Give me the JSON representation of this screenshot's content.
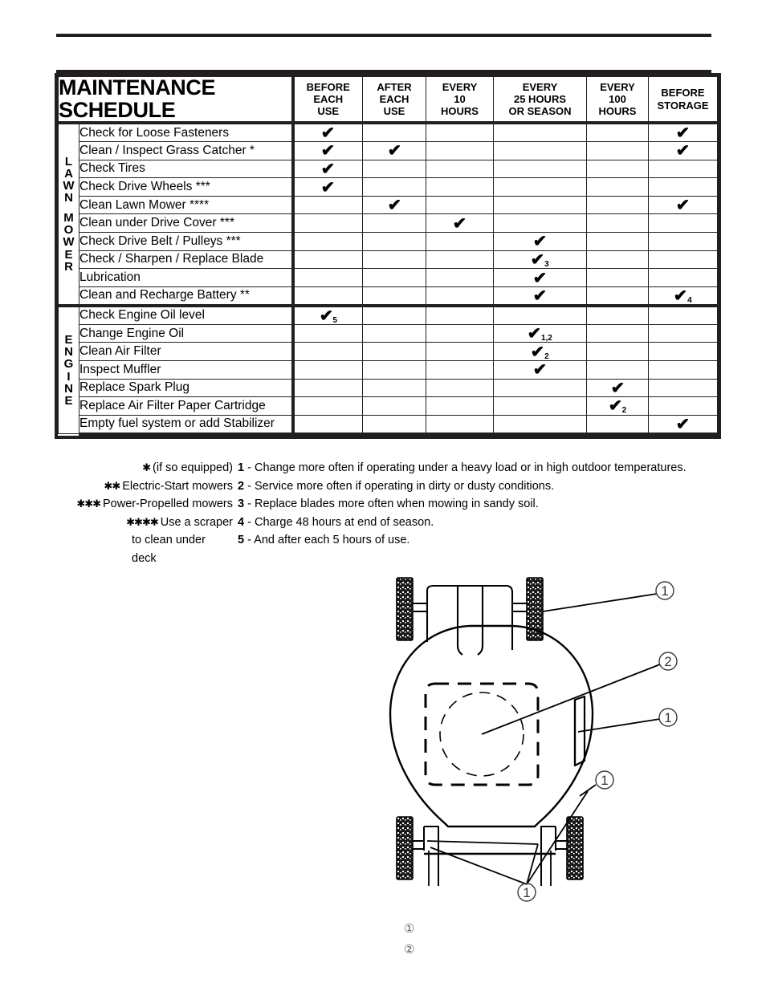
{
  "table": {
    "title_line1": "MAINTENANCE",
    "title_line2": "SCHEDULE",
    "columns": [
      {
        "id": "before_each_use",
        "lines": [
          "BEFORE",
          "EACH",
          "USE"
        ]
      },
      {
        "id": "after_each_use",
        "lines": [
          "AFTER",
          "EACH",
          "USE"
        ]
      },
      {
        "id": "every_10_hours",
        "lines": [
          "EVERY",
          "10",
          "HOURS"
        ]
      },
      {
        "id": "every_25_hours",
        "lines": [
          "EVERY",
          "25 HOURS",
          "OR SEASON"
        ]
      },
      {
        "id": "every_100_hours",
        "lines": [
          "EVERY",
          "100",
          "HOURS"
        ]
      },
      {
        "id": "before_storage",
        "lines": [
          "BEFORE",
          "STORAGE"
        ]
      }
    ],
    "sections": [
      {
        "label": "LAWN MOWER",
        "label_words": [
          "LAWN",
          "MOWER"
        ],
        "rows": [
          {
            "task": "Check for Loose Fasteners",
            "marks": [
              "check",
              "",
              "",
              "",
              "",
              "check"
            ]
          },
          {
            "task": "Clean / Inspect Grass Catcher *",
            "marks": [
              "check",
              "check",
              "",
              "",
              "",
              "check"
            ]
          },
          {
            "task": "Check Tires",
            "marks": [
              "check",
              "",
              "",
              "",
              "",
              ""
            ]
          },
          {
            "task": "Check Drive Wheels ***",
            "marks": [
              "check",
              "",
              "",
              "",
              "",
              ""
            ]
          },
          {
            "task": "Clean Lawn Mower ****",
            "marks": [
              "",
              "check",
              "",
              "",
              "",
              "check"
            ]
          },
          {
            "task": "Clean under Drive Cover ***",
            "marks": [
              "",
              "",
              "check",
              "",
              "",
              ""
            ]
          },
          {
            "task": "Check Drive Belt / Pulleys ***",
            "marks": [
              "",
              "",
              "",
              "check",
              "",
              ""
            ]
          },
          {
            "task": "Check / Sharpen / Replace Blade",
            "marks": [
              "",
              "",
              "",
              "check:3",
              "",
              ""
            ]
          },
          {
            "task": "Lubrication",
            "marks": [
              "",
              "",
              "",
              "check",
              "",
              ""
            ]
          },
          {
            "task": "Clean and Recharge Battery **",
            "marks": [
              "",
              "",
              "",
              "check",
              "",
              "check:4"
            ]
          }
        ]
      },
      {
        "label": "ENGINE",
        "label_words": [
          "ENGINE"
        ],
        "rows": [
          {
            "task": "Check Engine Oil level",
            "marks": [
              "check:5",
              "",
              "",
              "",
              "",
              ""
            ]
          },
          {
            "task": "Change Engine Oil",
            "marks": [
              "",
              "",
              "",
              "check:1,2",
              "",
              ""
            ]
          },
          {
            "task": "Clean Air Filter",
            "marks": [
              "",
              "",
              "",
              "check:2",
              "",
              ""
            ]
          },
          {
            "task": "Inspect Muffler",
            "marks": [
              "",
              "",
              "",
              "check",
              "",
              ""
            ]
          },
          {
            "task": "Replace Spark Plug",
            "marks": [
              "",
              "",
              "",
              "",
              "check",
              ""
            ]
          },
          {
            "task": "Replace Air Filter Paper Cartridge",
            "marks": [
              "",
              "",
              "",
              "",
              "check:2",
              ""
            ]
          },
          {
            "task": "Empty fuel system or add Stabilizer",
            "marks": [
              "",
              "",
              "",
              "",
              "",
              "check"
            ]
          }
        ]
      }
    ]
  },
  "footnotes": {
    "asterisks": [
      {
        "stars": "*",
        "text": "(if so equipped)"
      },
      {
        "stars": "**",
        "text": "Electric-Start mowers"
      },
      {
        "stars": "***",
        "text": "Power-Propelled mowers"
      },
      {
        "stars": "****",
        "text": "Use a scraper"
      }
    ],
    "asterisk_continuation": "to clean under deck",
    "numbered": [
      {
        "num": "1",
        "text": "- Change more often if operating under a heavy load or in high outdoor temperatures."
      },
      {
        "num": "2",
        "text": "- Service more often if operating in dirty or dusty conditions."
      },
      {
        "num": "3",
        "text": "- Replace blades more often when mowing in sandy soil."
      },
      {
        "num": "4",
        "text": "- Charge 48 hours at end of season."
      },
      {
        "num": "5",
        "text": "- And after each 5 hours of use."
      }
    ]
  },
  "diagram": {
    "callouts": [
      {
        "id": "callout-top-right",
        "num": "①"
      },
      {
        "id": "callout-middle-right",
        "num": "②"
      },
      {
        "id": "callout-lower-right",
        "num": "①"
      },
      {
        "id": "callout-deck-edge",
        "num": "①"
      },
      {
        "id": "callout-bottom-center",
        "num": "①"
      }
    ],
    "legend": [
      {
        "num": "①",
        "label": ""
      },
      {
        "num": "②",
        "label": ""
      }
    ]
  },
  "colors": {
    "ink": "#231f20",
    "paper": "#ffffff",
    "line": "#000000",
    "legend_gray": "#5b5b5b"
  }
}
